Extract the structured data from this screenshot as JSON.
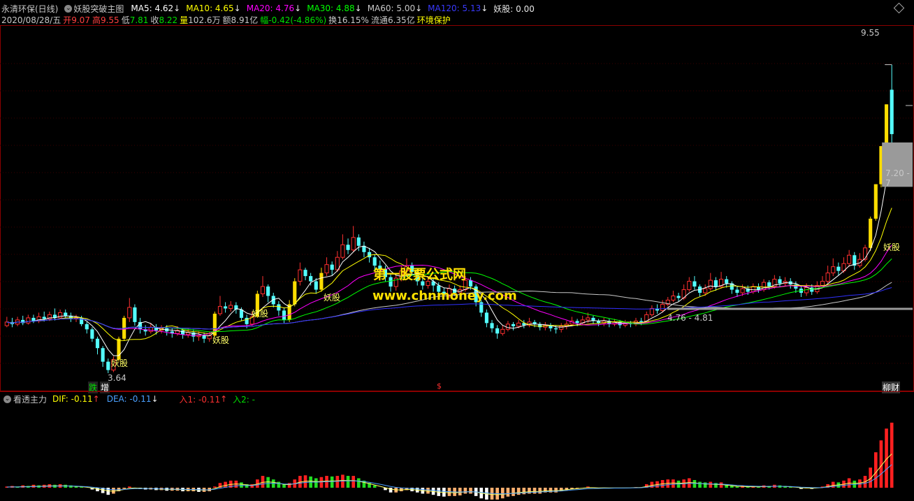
{
  "header": {
    "stock_name": "永清环保(日线)",
    "indicator_name": "妖股突破主图",
    "ma5": "MA5: 4.62",
    "ma10": "MA10: 4.65",
    "ma20": "MA20: 4.76",
    "ma30": "MA30: 4.88",
    "ma60": "MA60: 5.00",
    "ma120": "MA120: 5.13",
    "yaogu": "妖股: 0.00",
    "colors": {
      "ma5": "#ffffff",
      "ma10": "#ffff00",
      "ma20": "#ff00ff",
      "ma30": "#00ff00",
      "ma60": "#c8c8c8",
      "ma120": "#3030ff"
    }
  },
  "quote": {
    "date": "2020/08/28/五",
    "open_label": "开",
    "open": "9.07",
    "high_label": "高",
    "high": "9.55",
    "low_label": "低",
    "low": "7.81",
    "close_label": "收",
    "close": "8.22",
    "vol_label": "量",
    "vol": "102.6万",
    "amt_label": "额",
    "amt": "8.91亿",
    "chg_label": "幅",
    "chg": "-0.42(-4.86%)",
    "turn_label": "换",
    "turn": "16.15%",
    "float_label": "流通",
    "float": "6.35亿",
    "sector": "环境保护"
  },
  "annotations": {
    "high_price": "9.55",
    "low_price": "3.64",
    "range_upper": "7.20 - 7",
    "range_lower": "4.76 - 4.81",
    "yaogu_label": "妖股",
    "bottom_tags": [
      "跌",
      "增",
      "$",
      "柳财"
    ]
  },
  "watermark": {
    "line1": "第一股票公式网",
    "line2": "www.chnmoney.com"
  },
  "macd_header": {
    "name": "看透主力",
    "dif": "DIF: -0.11",
    "dea": "DEA: -0.11",
    "in1": "入1: -0.11",
    "in2": "入2: -"
  },
  "chart_data": [
    {
      "type": "candlestick",
      "title": "永清环保(日线)",
      "xlabel": "",
      "ylabel": "",
      "ylim": [
        3.4,
        10.2
      ],
      "series": [
        {
          "name": "MA5"
        },
        {
          "name": "MA10"
        },
        {
          "name": "MA20"
        },
        {
          "name": "MA30"
        },
        {
          "name": "MA60"
        },
        {
          "name": "MA120"
        }
      ],
      "candles": [
        [
          4.55,
          4.62,
          4.72,
          4.52
        ],
        [
          4.62,
          4.58,
          4.7,
          4.52
        ],
        [
          4.58,
          4.66,
          4.72,
          4.54
        ],
        [
          4.66,
          4.6,
          4.74,
          4.56
        ],
        [
          4.6,
          4.7,
          4.76,
          4.57
        ],
        [
          4.7,
          4.64,
          4.76,
          4.6
        ],
        [
          4.64,
          4.72,
          4.8,
          4.6
        ],
        [
          4.72,
          4.68,
          4.82,
          4.63
        ],
        [
          4.68,
          4.76,
          4.82,
          4.64
        ],
        [
          4.76,
          4.7,
          4.88,
          4.65
        ],
        [
          4.7,
          4.8,
          4.86,
          4.68
        ],
        [
          4.8,
          4.74,
          4.86,
          4.68
        ],
        [
          4.74,
          4.68,
          4.8,
          4.62
        ],
        [
          4.68,
          4.7,
          4.76,
          4.62
        ],
        [
          4.7,
          4.58,
          4.74,
          4.54
        ],
        [
          4.58,
          4.48,
          4.62,
          4.4
        ],
        [
          4.48,
          4.3,
          4.52,
          4.24
        ],
        [
          4.3,
          4.12,
          4.34,
          4.0
        ],
        [
          4.12,
          3.86,
          4.16,
          3.76
        ],
        [
          3.86,
          3.7,
          3.92,
          3.64
        ],
        [
          3.7,
          3.9,
          3.96,
          3.66
        ],
        [
          3.9,
          4.3,
          4.34,
          3.86
        ],
        [
          4.3,
          4.7,
          4.74,
          4.26
        ],
        [
          4.7,
          4.9,
          5.08,
          4.62
        ],
        [
          4.9,
          4.62,
          4.96,
          4.55
        ],
        [
          4.62,
          4.48,
          4.7,
          4.4
        ],
        [
          4.48,
          4.44,
          4.56,
          4.36
        ],
        [
          4.44,
          4.52,
          4.6,
          4.4
        ],
        [
          4.52,
          4.46,
          4.58,
          4.38
        ],
        [
          4.46,
          4.5,
          4.56,
          4.4
        ],
        [
          4.5,
          4.44,
          4.56,
          4.36
        ],
        [
          4.44,
          4.4,
          4.5,
          4.32
        ],
        [
          4.4,
          4.46,
          4.54,
          4.36
        ],
        [
          4.46,
          4.38,
          4.5,
          4.3
        ],
        [
          4.38,
          4.42,
          4.5,
          4.32
        ],
        [
          4.42,
          4.34,
          4.48,
          4.24
        ],
        [
          4.34,
          4.36,
          4.44,
          4.26
        ],
        [
          4.36,
          4.3,
          4.42,
          4.22
        ],
        [
          4.3,
          4.36,
          4.44,
          4.24
        ],
        [
          4.36,
          4.78,
          4.82,
          4.34
        ],
        [
          4.78,
          4.92,
          5.12,
          4.74
        ],
        [
          4.92,
          4.88,
          5.0,
          4.8
        ],
        [
          4.88,
          4.94,
          5.02,
          4.82
        ],
        [
          4.94,
          4.86,
          5.0,
          4.78
        ],
        [
          4.86,
          4.7,
          4.9,
          4.64
        ],
        [
          4.7,
          4.58,
          4.76,
          4.5
        ],
        [
          4.58,
          4.72,
          4.82,
          4.54
        ],
        [
          4.72,
          5.16,
          5.22,
          4.7
        ],
        [
          5.16,
          5.3,
          5.5,
          5.1
        ],
        [
          5.3,
          5.12,
          5.34,
          5.0
        ],
        [
          5.12,
          4.96,
          5.18,
          4.9
        ],
        [
          4.96,
          4.84,
          5.02,
          4.74
        ],
        [
          4.84,
          4.66,
          4.9,
          4.6
        ],
        [
          4.66,
          4.96,
          5.04,
          4.62
        ],
        [
          4.96,
          5.4,
          5.46,
          4.92
        ],
        [
          5.4,
          5.62,
          5.76,
          5.32
        ],
        [
          5.62,
          5.5,
          5.66,
          5.42
        ],
        [
          5.5,
          5.4,
          5.56,
          5.32
        ],
        [
          5.4,
          5.24,
          5.46,
          5.16
        ],
        [
          5.24,
          5.56,
          5.66,
          5.2
        ],
        [
          5.56,
          5.72,
          5.86,
          5.5
        ],
        [
          5.72,
          5.62,
          5.78,
          5.52
        ],
        [
          5.62,
          5.86,
          5.98,
          5.58
        ],
        [
          5.86,
          6.1,
          6.3,
          5.82
        ],
        [
          6.1,
          6.0,
          6.22,
          5.92
        ],
        [
          6.0,
          6.24,
          6.46,
          5.96
        ],
        [
          6.24,
          6.08,
          6.3,
          5.98
        ],
        [
          6.08,
          5.96,
          6.16,
          5.86
        ],
        [
          5.96,
          5.86,
          6.04,
          5.76
        ],
        [
          5.86,
          5.7,
          5.92,
          5.6
        ],
        [
          5.7,
          5.64,
          5.8,
          5.52
        ],
        [
          5.64,
          5.48,
          5.7,
          5.4
        ],
        [
          5.48,
          5.3,
          5.56,
          5.2
        ],
        [
          5.3,
          5.46,
          5.52,
          5.22
        ],
        [
          5.46,
          5.6,
          5.7,
          5.4
        ],
        [
          5.6,
          5.7,
          5.84,
          5.54
        ],
        [
          5.7,
          5.58,
          5.76,
          5.5
        ],
        [
          5.58,
          5.4,
          5.64,
          5.32
        ],
        [
          5.4,
          5.32,
          5.48,
          5.24
        ],
        [
          5.32,
          5.4,
          5.5,
          5.26
        ],
        [
          5.4,
          5.32,
          5.46,
          5.2
        ],
        [
          5.32,
          5.2,
          5.38,
          5.1
        ],
        [
          5.2,
          5.14,
          5.28,
          5.06
        ],
        [
          5.14,
          5.26,
          5.34,
          5.08
        ],
        [
          5.26,
          5.18,
          5.32,
          5.12
        ],
        [
          5.18,
          5.24,
          5.32,
          5.12
        ],
        [
          5.24,
          5.42,
          5.5,
          5.2
        ],
        [
          5.42,
          5.3,
          5.48,
          5.24
        ],
        [
          5.3,
          5.0,
          5.34,
          4.92
        ],
        [
          5.0,
          4.8,
          5.04,
          4.72
        ],
        [
          4.8,
          4.6,
          4.86,
          4.52
        ],
        [
          4.6,
          4.5,
          4.66,
          4.42
        ],
        [
          4.5,
          4.4,
          4.56,
          4.3
        ],
        [
          4.4,
          4.48,
          4.56,
          4.36
        ],
        [
          4.48,
          4.58,
          4.64,
          4.44
        ],
        [
          4.58,
          4.54,
          4.62,
          4.46
        ],
        [
          4.54,
          4.6,
          4.66,
          4.5
        ],
        [
          4.6,
          4.56,
          4.66,
          4.5
        ],
        [
          4.56,
          4.62,
          4.7,
          4.52
        ],
        [
          4.62,
          4.58,
          4.66,
          4.52
        ],
        [
          4.58,
          4.52,
          4.62,
          4.46
        ],
        [
          4.52,
          4.56,
          4.62,
          4.46
        ],
        [
          4.56,
          4.5,
          4.6,
          4.44
        ],
        [
          4.5,
          4.48,
          4.56,
          4.4
        ],
        [
          4.48,
          4.54,
          4.6,
          4.42
        ],
        [
          4.54,
          4.58,
          4.64,
          4.48
        ],
        [
          4.58,
          4.64,
          4.72,
          4.54
        ],
        [
          4.64,
          4.6,
          4.68,
          4.54
        ],
        [
          4.6,
          4.66,
          4.74,
          4.56
        ],
        [
          4.66,
          4.7,
          4.8,
          4.6
        ],
        [
          4.7,
          4.64,
          4.74,
          4.58
        ],
        [
          4.64,
          4.6,
          4.68,
          4.54
        ],
        [
          4.6,
          4.64,
          4.7,
          4.54
        ],
        [
          4.64,
          4.58,
          4.68,
          4.52
        ],
        [
          4.58,
          4.62,
          4.68,
          4.54
        ],
        [
          4.62,
          4.56,
          4.66,
          4.5
        ],
        [
          4.56,
          4.6,
          4.66,
          4.52
        ],
        [
          4.6,
          4.58,
          4.64,
          4.52
        ],
        [
          4.58,
          4.64,
          4.7,
          4.54
        ],
        [
          4.64,
          4.62,
          4.7,
          4.56
        ],
        [
          4.62,
          4.76,
          4.82,
          4.6
        ],
        [
          4.76,
          4.88,
          4.94,
          4.72
        ],
        [
          4.88,
          4.84,
          4.96,
          4.78
        ],
        [
          4.84,
          4.96,
          5.04,
          4.8
        ],
        [
          4.96,
          5.04,
          5.1,
          4.92
        ],
        [
          5.04,
          5.12,
          5.22,
          5.0
        ],
        [
          5.12,
          5.08,
          5.18,
          5.02
        ],
        [
          5.08,
          5.24,
          5.34,
          5.04
        ],
        [
          5.24,
          5.4,
          5.48,
          5.2
        ],
        [
          5.4,
          5.3,
          5.5,
          5.24
        ],
        [
          5.3,
          5.18,
          5.34,
          5.1
        ],
        [
          5.18,
          5.26,
          5.34,
          5.12
        ],
        [
          5.26,
          5.42,
          5.56,
          5.22
        ],
        [
          5.42,
          5.3,
          5.48,
          5.22
        ],
        [
          5.3,
          5.44,
          5.58,
          5.26
        ],
        [
          5.44,
          5.36,
          5.5,
          5.28
        ],
        [
          5.36,
          5.24,
          5.4,
          5.16
        ],
        [
          5.24,
          5.18,
          5.3,
          5.1
        ],
        [
          5.18,
          5.26,
          5.34,
          5.12
        ],
        [
          5.26,
          5.2,
          5.32,
          5.14
        ],
        [
          5.2,
          5.3,
          5.36,
          5.16
        ],
        [
          5.3,
          5.24,
          5.36,
          5.18
        ],
        [
          5.24,
          5.38,
          5.44,
          5.2
        ],
        [
          5.38,
          5.3,
          5.42,
          5.24
        ],
        [
          5.3,
          5.44,
          5.52,
          5.26
        ],
        [
          5.44,
          5.36,
          5.5,
          5.3
        ],
        [
          5.36,
          5.4,
          5.48,
          5.3
        ],
        [
          5.4,
          5.34,
          5.46,
          5.26
        ],
        [
          5.34,
          5.26,
          5.4,
          5.18
        ],
        [
          5.26,
          5.18,
          5.32,
          5.1
        ],
        [
          5.18,
          5.28,
          5.36,
          5.12
        ],
        [
          5.28,
          5.2,
          5.34,
          5.14
        ],
        [
          5.2,
          5.32,
          5.4,
          5.16
        ],
        [
          5.32,
          5.4,
          5.5,
          5.28
        ],
        [
          5.4,
          5.56,
          5.7,
          5.36
        ],
        [
          5.56,
          5.68,
          5.84,
          5.5
        ],
        [
          5.68,
          5.6,
          5.76,
          5.52
        ],
        [
          5.6,
          5.74,
          5.86,
          5.56
        ],
        [
          5.74,
          5.9,
          6.0,
          5.68
        ],
        [
          5.9,
          5.7,
          5.96,
          5.62
        ],
        [
          5.7,
          5.82,
          5.94,
          5.66
        ],
        [
          5.82,
          6.04,
          6.1,
          5.78
        ],
        [
          6.04,
          6.6,
          6.64,
          5.98
        ],
        [
          6.6,
          7.26,
          7.26,
          6.56
        ],
        [
          7.26,
          7.99,
          7.99,
          7.2
        ],
        [
          7.99,
          8.79,
          8.79,
          7.99
        ],
        [
          9.07,
          8.22,
          9.55,
          7.81
        ]
      ]
    },
    {
      "type": "bar",
      "title": "看透主力",
      "xlabel": "",
      "ylabel": "",
      "ylim": [
        -0.3,
        1.2
      ],
      "series": [
        {
          "name": "DIF"
        },
        {
          "name": "DEA"
        }
      ],
      "values": [
        0.02,
        0.03,
        0.02,
        0.04,
        0.03,
        0.05,
        0.04,
        0.05,
        0.06,
        0.05,
        0.06,
        0.05,
        0.04,
        0.03,
        0.02,
        0.0,
        -0.03,
        -0.06,
        -0.09,
        -0.12,
        -0.1,
        -0.06,
        -0.02,
        0.02,
        0.0,
        -0.02,
        -0.03,
        -0.03,
        -0.04,
        -0.04,
        -0.05,
        -0.05,
        -0.05,
        -0.06,
        -0.06,
        -0.06,
        -0.07,
        -0.07,
        -0.06,
        0.02,
        0.08,
        0.1,
        0.12,
        0.12,
        0.09,
        0.06,
        0.06,
        0.14,
        0.2,
        0.18,
        0.14,
        0.1,
        0.06,
        0.08,
        0.14,
        0.2,
        0.21,
        0.19,
        0.16,
        0.18,
        0.2,
        0.19,
        0.2,
        0.22,
        0.2,
        0.2,
        0.16,
        0.12,
        0.08,
        0.04,
        0.0,
        -0.04,
        -0.08,
        -0.08,
        -0.06,
        -0.04,
        -0.06,
        -0.08,
        -0.1,
        -0.1,
        -0.12,
        -0.14,
        -0.15,
        -0.14,
        -0.14,
        -0.13,
        -0.1,
        -0.1,
        -0.14,
        -0.18,
        -0.2,
        -0.2,
        -0.2,
        -0.18,
        -0.15,
        -0.14,
        -0.12,
        -0.11,
        -0.1,
        -0.1,
        -0.1,
        -0.08,
        -0.08,
        -0.08,
        -0.06,
        -0.04,
        -0.02,
        -0.01,
        0.0,
        0.02,
        0.0,
        -0.01,
        0.0,
        -0.01,
        0.0,
        -0.01,
        0.0,
        0.0,
        0.01,
        0.01,
        0.06,
        0.1,
        0.11,
        0.13,
        0.14,
        0.14,
        0.12,
        0.14,
        0.16,
        0.13,
        0.1,
        0.09,
        0.1,
        0.08,
        0.09,
        0.06,
        0.04,
        0.02,
        0.03,
        0.02,
        0.03,
        0.02,
        0.04,
        0.03,
        0.05,
        0.04,
        0.03,
        0.02,
        0.0,
        -0.02,
        -0.01,
        -0.02,
        0.0,
        0.02,
        0.06,
        0.1,
        0.09,
        0.12,
        0.16,
        0.12,
        0.14,
        0.2,
        0.34,
        0.6,
        0.8,
        1.0,
        1.1
      ]
    }
  ]
}
